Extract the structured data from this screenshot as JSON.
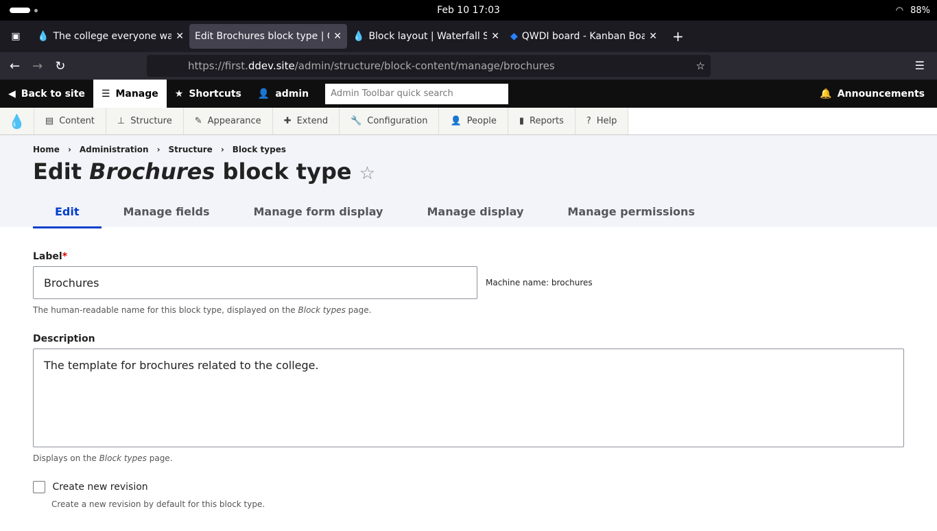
{
  "system": {
    "datetime": "Feb 10  17:03",
    "battery": "88%"
  },
  "browser": {
    "tabs": [
      "The college everyone wan",
      "Edit Brochures block type | C",
      "Block layout | Waterfall Si",
      "QWDI board - Kanban Boa"
    ],
    "url_prefix": "https://first.",
    "url_domain": "ddev.site",
    "url_path": "/admin/structure/block-content/manage/brochures"
  },
  "toolbar": {
    "back": "Back to site",
    "manage": "Manage",
    "shortcuts": "Shortcuts",
    "user": "admin",
    "search_placeholder": "Admin Toolbar quick search",
    "announcements": "Announcements"
  },
  "tray": [
    "Content",
    "Structure",
    "Appearance",
    "Extend",
    "Configuration",
    "People",
    "Reports",
    "Help"
  ],
  "breadcrumb": [
    "Home",
    "Administration",
    "Structure",
    "Block types"
  ],
  "title": {
    "pre": "Edit ",
    "em": "Brochures",
    "post": " block type"
  },
  "tabs": [
    "Edit",
    "Manage fields",
    "Manage form display",
    "Manage display",
    "Manage permissions"
  ],
  "form": {
    "label": "Label",
    "label_value": "Brochures",
    "machine": "Machine name: brochures",
    "label_help_pre": "The human-readable name for this block type, displayed on the ",
    "label_help_em": "Block types",
    "label_help_post": " page.",
    "desc_label": "Description",
    "desc_value": "The template for brochures related to the college.",
    "desc_help_pre": "Displays on the ",
    "desc_help_em": "Block types",
    "desc_help_post": " page.",
    "revision": "Create new revision",
    "revision_help": "Create a new revision by default for this block type."
  }
}
